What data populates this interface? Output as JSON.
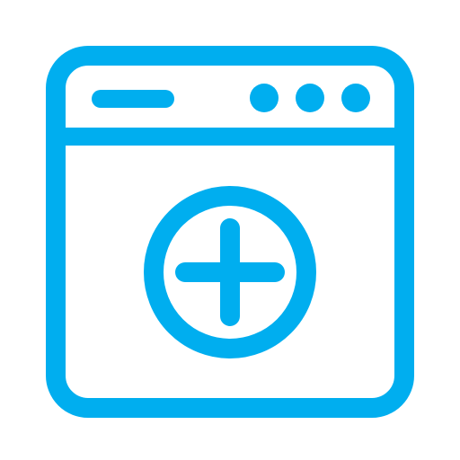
{
  "icon": {
    "name": "add-window-icon",
    "parts": {
      "window_frame": "window-frame",
      "title_bar": "title-bar",
      "title_placeholder": "title-bar-placeholder-line",
      "control_dots": [
        "window-dot-1",
        "window-dot-2",
        "window-dot-3"
      ],
      "add_symbol": "plus-circle-icon"
    }
  },
  "colors": {
    "stroke": "#00AEEF",
    "background": "#FFFFFF"
  }
}
